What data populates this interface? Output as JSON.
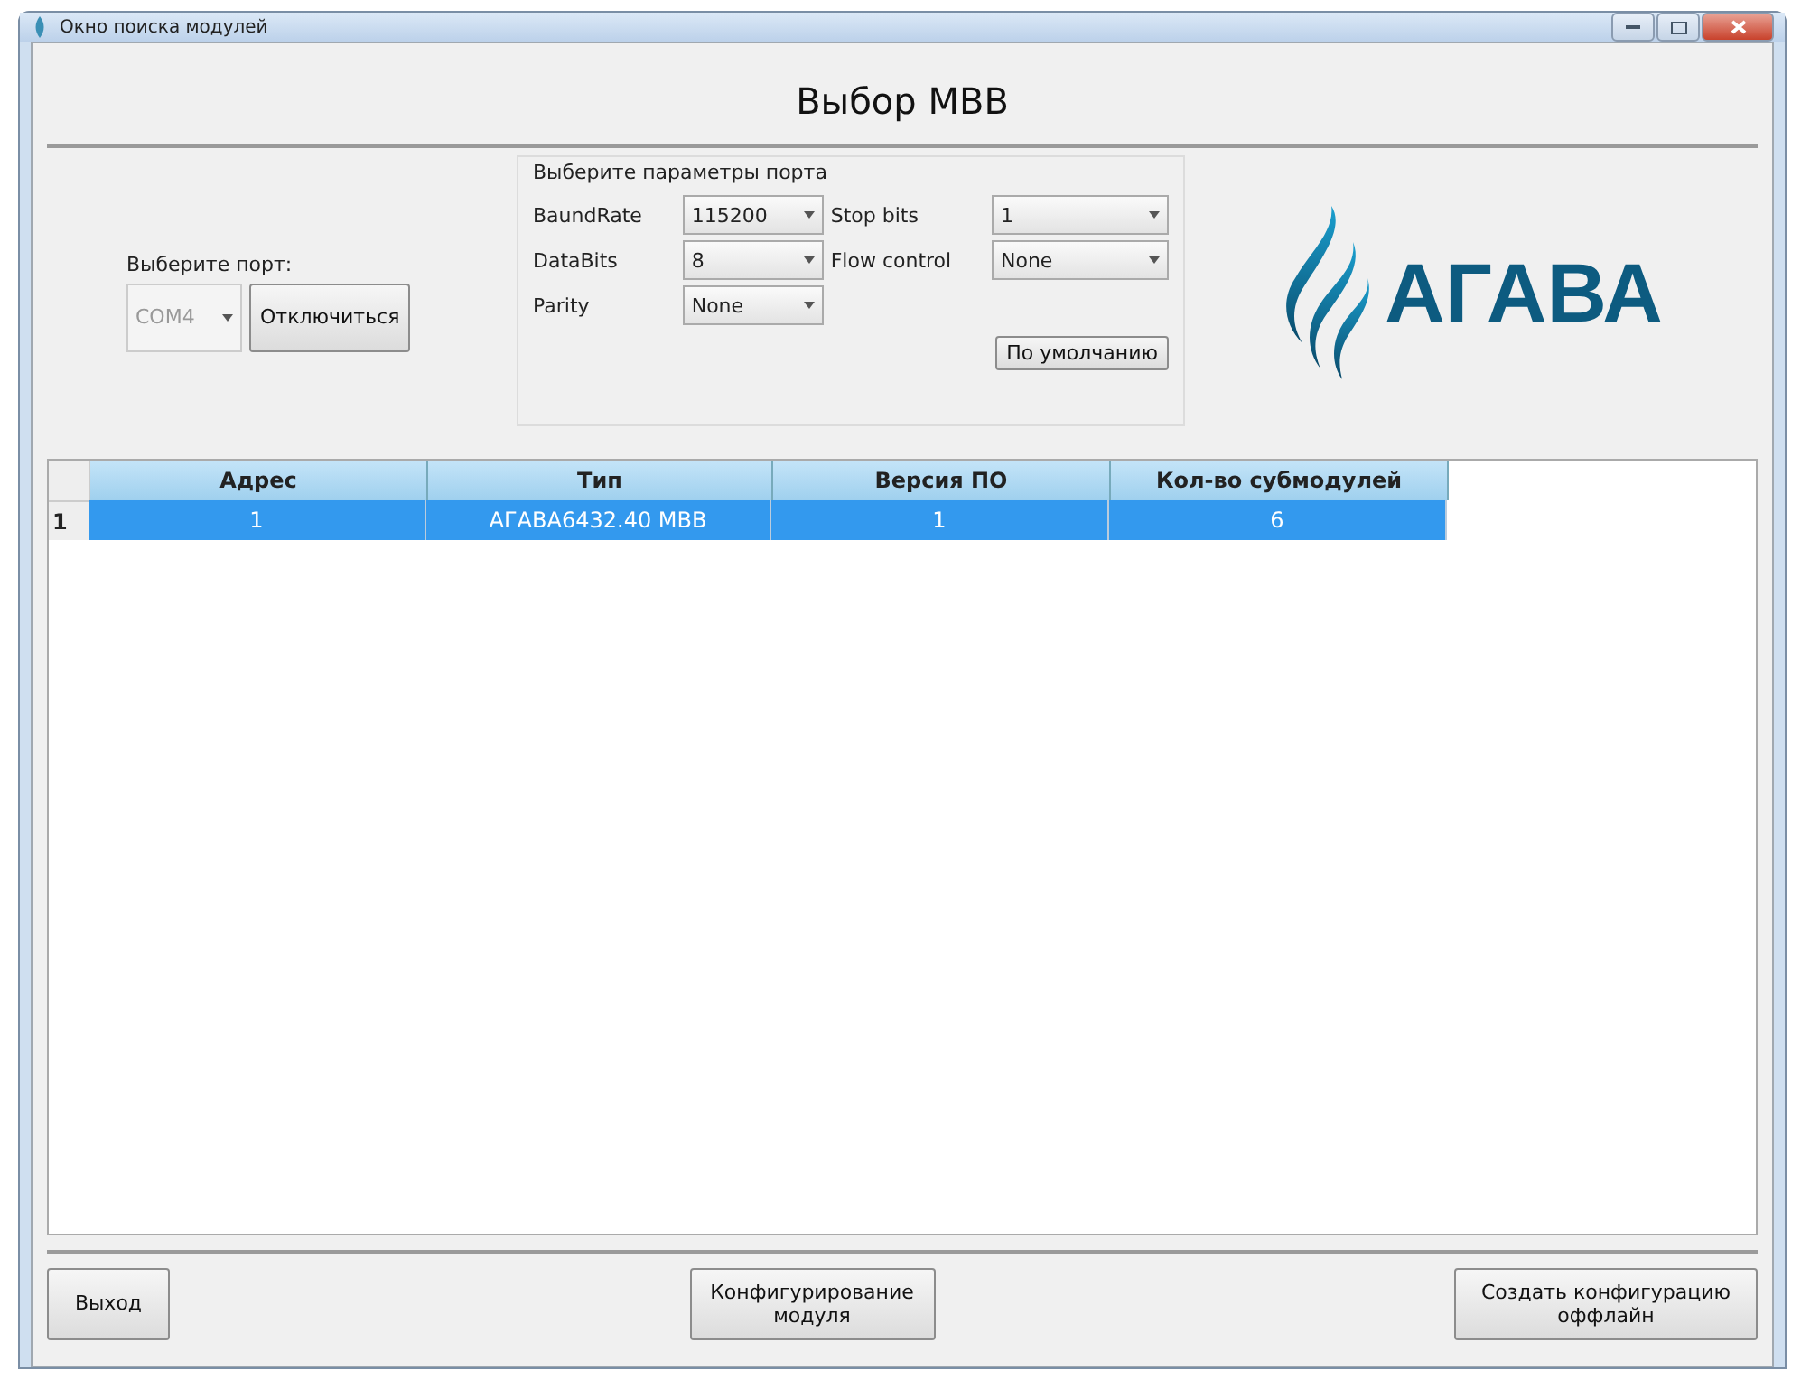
{
  "window": {
    "title": "Окно поиска модулей"
  },
  "heading": "Выбор МВВ",
  "port": {
    "label": "Выберите порт:",
    "value": "COM4",
    "disabled": true,
    "button": "Отключиться"
  },
  "port_params": {
    "title": "Выберите параметры порта",
    "fields": [
      {
        "label": "BaundRate",
        "value": "115200"
      },
      {
        "label": "Stop bits",
        "value": "1"
      },
      {
        "label": "DataBits",
        "value": "8"
      },
      {
        "label": "Flow control",
        "value": "None"
      },
      {
        "label": "Parity",
        "value": "None"
      }
    ],
    "default_button": "По умолчанию"
  },
  "logo": {
    "text": "АГАВА"
  },
  "table": {
    "columns": [
      "Адрес",
      "Тип",
      "Версия ПО",
      "Кол-во субмодулей"
    ],
    "rows": [
      {
        "number": "1",
        "selected": true,
        "cells": [
          "1",
          "АГАВА6432.40 МВВ",
          "1",
          "6"
        ]
      }
    ]
  },
  "buttons": [
    {
      "label": "Выход"
    },
    {
      "label": "Конфигурирование модуля"
    },
    {
      "label": "Создать конфигурацию оффлайн"
    }
  ]
}
